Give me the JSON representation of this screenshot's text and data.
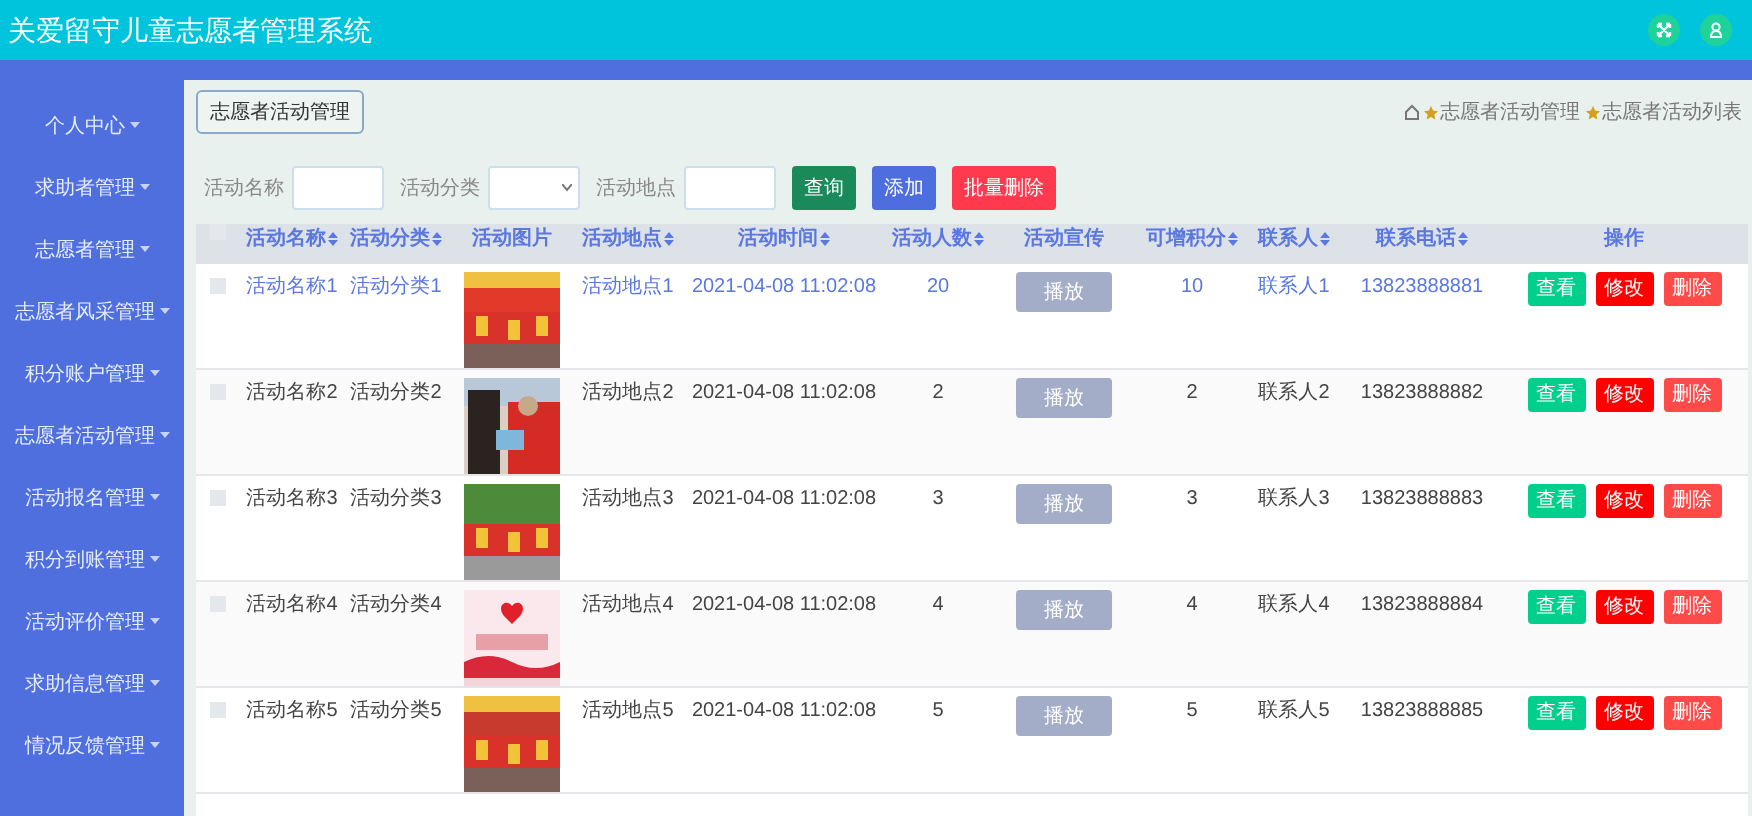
{
  "header": {
    "title": "关爱留守儿童志愿者管理系统"
  },
  "sidebar": {
    "items": [
      {
        "label": "个人中心"
      },
      {
        "label": "求助者管理"
      },
      {
        "label": "志愿者管理"
      },
      {
        "label": "志愿者风采管理"
      },
      {
        "label": "积分账户管理"
      },
      {
        "label": "志愿者活动管理"
      },
      {
        "label": "活动报名管理"
      },
      {
        "label": "积分到账管理"
      },
      {
        "label": "活动评价管理"
      },
      {
        "label": "求助信息管理"
      },
      {
        "label": "情况反馈管理"
      }
    ]
  },
  "page_tab": "志愿者活动管理",
  "breadcrumb": [
    "志愿者活动管理",
    "志愿者活动列表"
  ],
  "search": {
    "fields": [
      {
        "label": "活动名称",
        "kind": "text"
      },
      {
        "label": "活动分类",
        "kind": "select"
      },
      {
        "label": "活动地点",
        "kind": "text"
      }
    ],
    "buttons": [
      {
        "label": "查询",
        "kind": "search"
      },
      {
        "label": "添加",
        "kind": "add"
      },
      {
        "label": "批量删除",
        "kind": "delete"
      }
    ]
  },
  "table": {
    "select_all": {
      "checked": false
    },
    "columns": [
      {
        "label": "活动名称",
        "sortable": true
      },
      {
        "label": "活动分类",
        "sortable": true
      },
      {
        "label": "活动图片",
        "sortable": false
      },
      {
        "label": "活动地点",
        "sortable": true
      },
      {
        "label": "活动时间",
        "sortable": true
      },
      {
        "label": "活动人数",
        "sortable": true
      },
      {
        "label": "活动宣传",
        "sortable": false
      },
      {
        "label": "可增积分",
        "sortable": true
      },
      {
        "label": "联系人",
        "sortable": true
      },
      {
        "label": "联系电话",
        "sortable": true
      },
      {
        "label": "操作",
        "sortable": false
      }
    ],
    "rows": [
      {
        "checked": false,
        "highlighted": true,
        "name": "活动名称1",
        "category": "活动分类1",
        "location": "活动地点1",
        "time": "2021-04-08 11:02:08",
        "people": "20",
        "promo": "播放",
        "points": "10",
        "contact": "联系人1",
        "phone": "13823888881",
        "actions": [
          "查看",
          "修改",
          "删除"
        ]
      },
      {
        "checked": false,
        "highlighted": false,
        "name": "活动名称2",
        "category": "活动分类2",
        "location": "活动地点2",
        "time": "2021-04-08 11:02:08",
        "people": "2",
        "promo": "播放",
        "points": "2",
        "contact": "联系人2",
        "phone": "13823888882",
        "actions": [
          "查看",
          "修改",
          "删除"
        ]
      },
      {
        "checked": false,
        "highlighted": false,
        "name": "活动名称3",
        "category": "活动分类3",
        "location": "活动地点3",
        "time": "2021-04-08 11:02:08",
        "people": "3",
        "promo": "播放",
        "points": "3",
        "contact": "联系人3",
        "phone": "13823888883",
        "actions": [
          "查看",
          "修改",
          "删除"
        ]
      },
      {
        "checked": false,
        "highlighted": false,
        "name": "活动名称4",
        "category": "活动分类4",
        "location": "活动地点4",
        "time": "2021-04-08 11:02:08",
        "people": "4",
        "promo": "播放",
        "points": "4",
        "contact": "联系人4",
        "phone": "13823888884",
        "actions": [
          "查看",
          "修改",
          "删除"
        ]
      },
      {
        "checked": false,
        "highlighted": false,
        "name": "活动名称5",
        "category": "活动分类5",
        "location": "活动地点5",
        "time": "2021-04-08 11:02:08",
        "people": "5",
        "promo": "播放",
        "points": "5",
        "contact": "联系人5",
        "phone": "13823888885",
        "actions": [
          "查看",
          "修改",
          "删除"
        ]
      }
    ]
  }
}
